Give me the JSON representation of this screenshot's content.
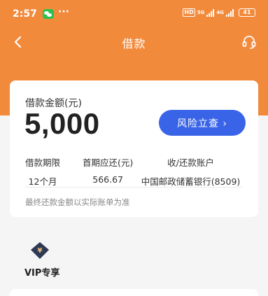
{
  "status_bar": {
    "time": "2:57",
    "more": "···",
    "hd": "HD",
    "net1": "5G",
    "net2": "4G",
    "battery": "41"
  },
  "nav": {
    "title": "借款"
  },
  "loan": {
    "amount_label": "借款金额(元)",
    "amount": "5,000",
    "risk_button": "风险立查 ›",
    "term_label": "借款期限",
    "term_value": "12个月",
    "first_repay_label": "首期应还(元)",
    "first_repay_value": "566.67",
    "account_label": "收/还款账户",
    "account_value": "中国邮政储蓄银行(8509)",
    "note": "最终还款金额以实际账单为准"
  },
  "vip": {
    "label": "VIP专享"
  },
  "colors": {
    "header": "#f28a3c",
    "button": "#3a64e8"
  }
}
